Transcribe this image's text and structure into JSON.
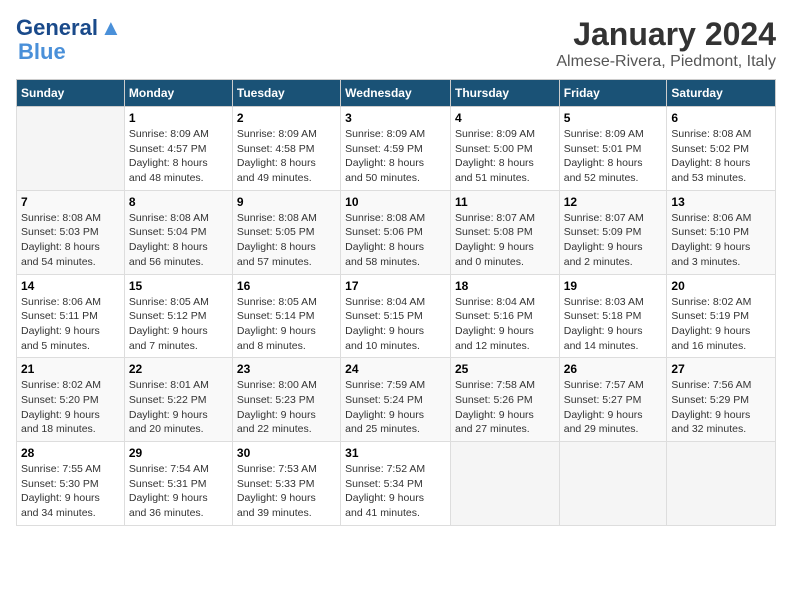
{
  "header": {
    "logo_line1": "General",
    "logo_line2": "Blue",
    "title": "January 2024",
    "subtitle": "Almese-Rivera, Piedmont, Italy"
  },
  "weekdays": [
    "Sunday",
    "Monday",
    "Tuesday",
    "Wednesday",
    "Thursday",
    "Friday",
    "Saturday"
  ],
  "weeks": [
    [
      {
        "num": "",
        "info": ""
      },
      {
        "num": "1",
        "info": "Sunrise: 8:09 AM\nSunset: 4:57 PM\nDaylight: 8 hours\nand 48 minutes."
      },
      {
        "num": "2",
        "info": "Sunrise: 8:09 AM\nSunset: 4:58 PM\nDaylight: 8 hours\nand 49 minutes."
      },
      {
        "num": "3",
        "info": "Sunrise: 8:09 AM\nSunset: 4:59 PM\nDaylight: 8 hours\nand 50 minutes."
      },
      {
        "num": "4",
        "info": "Sunrise: 8:09 AM\nSunset: 5:00 PM\nDaylight: 8 hours\nand 51 minutes."
      },
      {
        "num": "5",
        "info": "Sunrise: 8:09 AM\nSunset: 5:01 PM\nDaylight: 8 hours\nand 52 minutes."
      },
      {
        "num": "6",
        "info": "Sunrise: 8:08 AM\nSunset: 5:02 PM\nDaylight: 8 hours\nand 53 minutes."
      }
    ],
    [
      {
        "num": "7",
        "info": "Sunrise: 8:08 AM\nSunset: 5:03 PM\nDaylight: 8 hours\nand 54 minutes."
      },
      {
        "num": "8",
        "info": "Sunrise: 8:08 AM\nSunset: 5:04 PM\nDaylight: 8 hours\nand 56 minutes."
      },
      {
        "num": "9",
        "info": "Sunrise: 8:08 AM\nSunset: 5:05 PM\nDaylight: 8 hours\nand 57 minutes."
      },
      {
        "num": "10",
        "info": "Sunrise: 8:08 AM\nSunset: 5:06 PM\nDaylight: 8 hours\nand 58 minutes."
      },
      {
        "num": "11",
        "info": "Sunrise: 8:07 AM\nSunset: 5:08 PM\nDaylight: 9 hours\nand 0 minutes."
      },
      {
        "num": "12",
        "info": "Sunrise: 8:07 AM\nSunset: 5:09 PM\nDaylight: 9 hours\nand 2 minutes."
      },
      {
        "num": "13",
        "info": "Sunrise: 8:06 AM\nSunset: 5:10 PM\nDaylight: 9 hours\nand 3 minutes."
      }
    ],
    [
      {
        "num": "14",
        "info": "Sunrise: 8:06 AM\nSunset: 5:11 PM\nDaylight: 9 hours\nand 5 minutes."
      },
      {
        "num": "15",
        "info": "Sunrise: 8:05 AM\nSunset: 5:12 PM\nDaylight: 9 hours\nand 7 minutes."
      },
      {
        "num": "16",
        "info": "Sunrise: 8:05 AM\nSunset: 5:14 PM\nDaylight: 9 hours\nand 8 minutes."
      },
      {
        "num": "17",
        "info": "Sunrise: 8:04 AM\nSunset: 5:15 PM\nDaylight: 9 hours\nand 10 minutes."
      },
      {
        "num": "18",
        "info": "Sunrise: 8:04 AM\nSunset: 5:16 PM\nDaylight: 9 hours\nand 12 minutes."
      },
      {
        "num": "19",
        "info": "Sunrise: 8:03 AM\nSunset: 5:18 PM\nDaylight: 9 hours\nand 14 minutes."
      },
      {
        "num": "20",
        "info": "Sunrise: 8:02 AM\nSunset: 5:19 PM\nDaylight: 9 hours\nand 16 minutes."
      }
    ],
    [
      {
        "num": "21",
        "info": "Sunrise: 8:02 AM\nSunset: 5:20 PM\nDaylight: 9 hours\nand 18 minutes."
      },
      {
        "num": "22",
        "info": "Sunrise: 8:01 AM\nSunset: 5:22 PM\nDaylight: 9 hours\nand 20 minutes."
      },
      {
        "num": "23",
        "info": "Sunrise: 8:00 AM\nSunset: 5:23 PM\nDaylight: 9 hours\nand 22 minutes."
      },
      {
        "num": "24",
        "info": "Sunrise: 7:59 AM\nSunset: 5:24 PM\nDaylight: 9 hours\nand 25 minutes."
      },
      {
        "num": "25",
        "info": "Sunrise: 7:58 AM\nSunset: 5:26 PM\nDaylight: 9 hours\nand 27 minutes."
      },
      {
        "num": "26",
        "info": "Sunrise: 7:57 AM\nSunset: 5:27 PM\nDaylight: 9 hours\nand 29 minutes."
      },
      {
        "num": "27",
        "info": "Sunrise: 7:56 AM\nSunset: 5:29 PM\nDaylight: 9 hours\nand 32 minutes."
      }
    ],
    [
      {
        "num": "28",
        "info": "Sunrise: 7:55 AM\nSunset: 5:30 PM\nDaylight: 9 hours\nand 34 minutes."
      },
      {
        "num": "29",
        "info": "Sunrise: 7:54 AM\nSunset: 5:31 PM\nDaylight: 9 hours\nand 36 minutes."
      },
      {
        "num": "30",
        "info": "Sunrise: 7:53 AM\nSunset: 5:33 PM\nDaylight: 9 hours\nand 39 minutes."
      },
      {
        "num": "31",
        "info": "Sunrise: 7:52 AM\nSunset: 5:34 PM\nDaylight: 9 hours\nand 41 minutes."
      },
      {
        "num": "",
        "info": ""
      },
      {
        "num": "",
        "info": ""
      },
      {
        "num": "",
        "info": ""
      }
    ]
  ]
}
